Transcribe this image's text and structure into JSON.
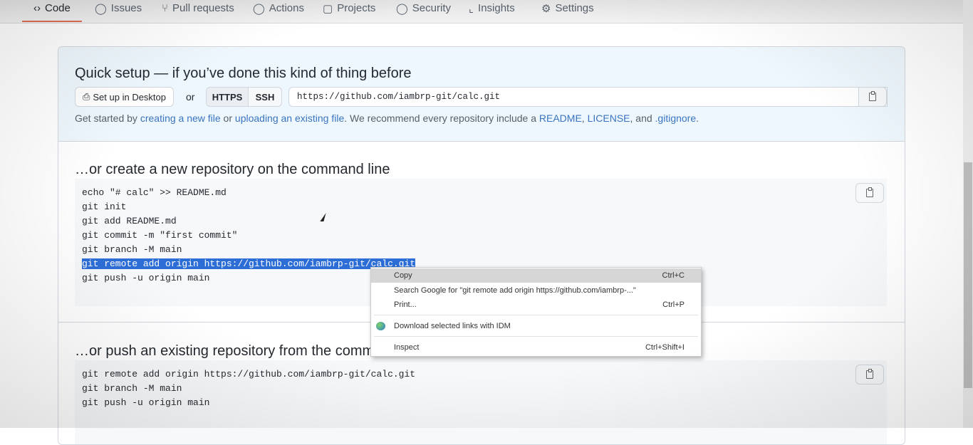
{
  "nav": {
    "tabs": [
      {
        "label": "Code",
        "icon": "code-icon"
      },
      {
        "label": "Issues",
        "icon": "issue-icon"
      },
      {
        "label": "Pull requests",
        "icon": "pull-request-icon"
      },
      {
        "label": "Actions",
        "icon": "play-icon"
      },
      {
        "label": "Projects",
        "icon": "table-icon"
      },
      {
        "label": "Security",
        "icon": "shield-icon"
      },
      {
        "label": "Insights",
        "icon": "graph-icon"
      },
      {
        "label": "Settings",
        "icon": "gear-icon"
      }
    ]
  },
  "quick": {
    "title": "Quick setup — if you’ve done this kind of thing before",
    "desktop": "Set up in Desktop",
    "or": "or",
    "https": "HTTPS",
    "ssh": "SSH",
    "url": "https://github.com/iambrp-git/calc.git",
    "t1": "Get started by ",
    "l1": "creating a new file",
    "t2": " or ",
    "l2": "uploading an existing file",
    "t3": ". We recommend every repository include a ",
    "l3": "README",
    "t4": ", ",
    "l4": "LICENSE",
    "t5": ", and ",
    "l5": ".gitignore",
    "t6": "."
  },
  "create": {
    "title": "…or create a new repository on the command line",
    "lines": [
      "echo \"# calc\" >> README.md",
      "git init",
      "git add README.md",
      "git commit -m \"first commit\"",
      "git branch -M main",
      "git remote add origin https://github.com/iambrp-git/calc.git",
      "git push -u origin main"
    ]
  },
  "push": {
    "title": "…or push an existing repository from the command line",
    "lines": [
      "git remote add origin https://github.com/iambrp-git/calc.git",
      "git branch -M main",
      "git push -u origin main"
    ]
  },
  "menu": {
    "copy": "Copy",
    "copy_sc": "Ctrl+C",
    "search": "Search Google for \"git remote add origin https://github.com/iambrp-...\"",
    "print": "Print...",
    "print_sc": "Ctrl+P",
    "idm": "Download selected links with IDM",
    "inspect": "Inspect",
    "inspect_sc": "Ctrl+Shift+I"
  },
  "colors": {
    "link": "#3a74c0",
    "selection": "#2d6ed6",
    "quick_bg": "#eef7fd"
  }
}
